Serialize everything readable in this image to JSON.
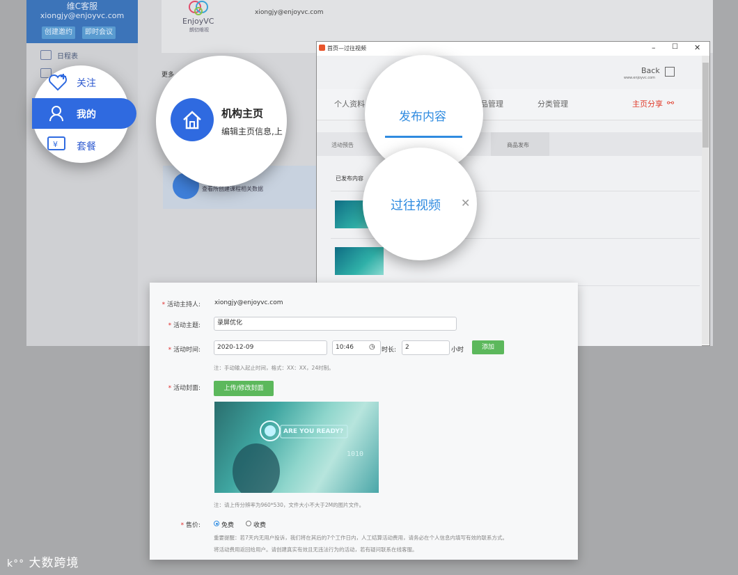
{
  "sidebar": {
    "user_name": "维C客服",
    "user_email": "xiongjy@enjoyvc.com",
    "btn_create": "创建邀约",
    "btn_meeting": "即时会议",
    "item_schedule": "日程表",
    "nav_follow": "关注",
    "nav_mine": "我的",
    "nav_package": "套餐"
  },
  "header": {
    "logo_text": "EnjoyVC",
    "logo_sub": "朗仞维视",
    "email": "xiongjy@enjoyvc.com"
  },
  "main": {
    "more_label": "更多",
    "home_card_title": "机构主页",
    "home_card_desc": "编辑主页信息,上",
    "card2_text": "查看所创建课程相关数据"
  },
  "dialog": {
    "title": "首页—过往视频",
    "minimize": "–",
    "maximize": "☐",
    "close": "✕",
    "back_label": "Back",
    "back_url": "www.enjoyvc.com",
    "tabs": [
      "个人资料",
      "发布内容",
      "品管理",
      "分类管理"
    ],
    "share_label": "主页分享",
    "subtabs": [
      "活动预告",
      "商品发布"
    ],
    "video_tab": "过往视频",
    "video_tab_close": "✕",
    "published_label": "已发布内容"
  },
  "form": {
    "host_label": "活动主持人:",
    "host_value": "xiongjy@enjoyvc.com",
    "topic_label": "活动主题:",
    "topic_value": "录屏优化",
    "time_label": "活动时间:",
    "date_value": "2020-12-09",
    "time_value": "10:46",
    "duration_label": "时长:",
    "duration_value": "2",
    "duration_unit": "小时",
    "add_button": "添加",
    "time_note": "注：手动输入起止时间，格式：XX：XX，24时制。",
    "cover_label": "活动封面:",
    "upload_button": "上传/修改封面",
    "cover_text": "ARE YOU READY?",
    "cover_note": "注：请上传分辨率为960*530，文件大小不大于2M的图片文件。",
    "price_label": "售价:",
    "price_free": "免费",
    "price_paid": "收费",
    "notice_line1": "重要提醒：若7天内无用户投诉，我们将在其后的7个工作日内，人工结算活动费用，请务必在个人信息内填写有效的联系方式。",
    "notice_line2": "将活动费用返回给用户。请创建真实有效且无违法行为的活动，若有疑问联系在线客服。"
  },
  "watermark": "大数跨境",
  "colors": {
    "accent_blue": "#2f6ae0",
    "share_red": "#e03b2a",
    "button_green": "#5cb85c",
    "required_red": "#e02a2a"
  }
}
